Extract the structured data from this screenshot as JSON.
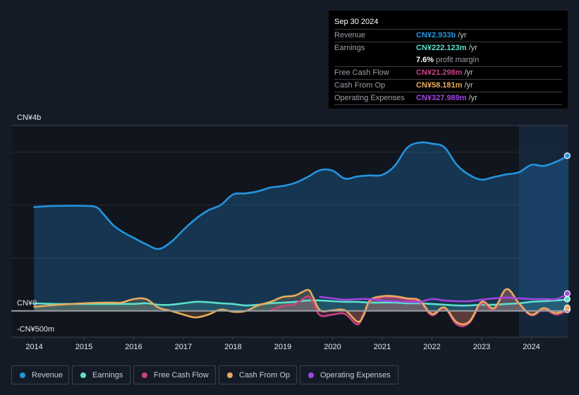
{
  "tooltip": {
    "date": "Sep 30 2024",
    "rows": [
      {
        "label": "Revenue",
        "value": "CN¥2.933b",
        "unit": "/yr",
        "color": "#2394df"
      },
      {
        "label": "Earnings",
        "value": "CN¥222.123m",
        "unit": "/yr",
        "color": "#5ce0cc"
      },
      {
        "label": "",
        "value": "7.6%",
        "unit": "profit margin",
        "color": "#ffffff"
      },
      {
        "label": "Free Cash Flow",
        "value": "CN¥21.298m",
        "unit": "/yr",
        "color": "#c64382"
      },
      {
        "label": "Cash From Op",
        "value": "CN¥58.181m",
        "unit": "/yr",
        "color": "#e8ac5c"
      },
      {
        "label": "Operating Expenses",
        "value": "CN¥327.989m",
        "unit": "/yr",
        "color": "#a245e0"
      }
    ]
  },
  "legend": [
    {
      "label": "Revenue",
      "color": "#2394df"
    },
    {
      "label": "Earnings",
      "color": "#5ce0cc"
    },
    {
      "label": "Free Cash Flow",
      "color": "#c64382"
    },
    {
      "label": "Cash From Op",
      "color": "#e8ac5c"
    },
    {
      "label": "Operating Expenses",
      "color": "#a245e0"
    }
  ],
  "chart_data": {
    "type": "area",
    "title": "",
    "xlabel": "",
    "ylabel": "",
    "y_unit": "CN¥ millions",
    "ylim": [
      -500,
      4000
    ],
    "xlim": [
      2013.55,
      2024.8
    ],
    "y_tick_labels": [
      {
        "value": 4000,
        "label": "CN¥4b"
      },
      {
        "value": 0,
        "label": "CN¥0"
      },
      {
        "value": -500,
        "label": "-CN¥500m"
      }
    ],
    "y_gridlines": [
      1000,
      2000,
      3000
    ],
    "x_ticks": [
      2014,
      2015,
      2016,
      2017,
      2018,
      2019,
      2020,
      2021,
      2022,
      2023,
      2024
    ],
    "x_tick_labels": [
      "2014",
      "2015",
      "2016",
      "2017",
      "2018",
      "2019",
      "2020",
      "2021",
      "2022",
      "2023",
      "2024"
    ],
    "highlight_range": [
      2023.75,
      2024.75
    ],
    "grid": true,
    "legend_position": "bottom-left",
    "series": [
      {
        "name": "Revenue",
        "color": "#2394df",
        "filled": true,
        "x": [
          2014.0,
          2014.3,
          2014.6,
          2015.0,
          2015.25,
          2015.4,
          2015.6,
          2015.8,
          2016.0,
          2016.25,
          2016.5,
          2016.75,
          2017.0,
          2017.25,
          2017.5,
          2017.75,
          2018.0,
          2018.25,
          2018.5,
          2018.75,
          2019.0,
          2019.25,
          2019.5,
          2019.75,
          2020.0,
          2020.25,
          2020.5,
          2020.75,
          2021.0,
          2021.25,
          2021.5,
          2021.75,
          2022.0,
          2022.25,
          2022.5,
          2022.75,
          2023.0,
          2023.25,
          2023.5,
          2023.75,
          2024.0,
          2024.25,
          2024.5,
          2024.75
        ],
        "y": [
          1960,
          1980,
          1985,
          1985,
          1960,
          1820,
          1610,
          1480,
          1380,
          1260,
          1170,
          1300,
          1530,
          1740,
          1900,
          2000,
          2200,
          2220,
          2260,
          2330,
          2360,
          2420,
          2530,
          2660,
          2650,
          2500,
          2540,
          2560,
          2570,
          2740,
          3080,
          3180,
          3160,
          3090,
          2760,
          2570,
          2480,
          2530,
          2580,
          2620,
          2760,
          2740,
          2820,
          2933
        ]
      },
      {
        "name": "Earnings",
        "color": "#5ce0cc",
        "filled": true,
        "x": [
          2014.0,
          2014.5,
          2015.0,
          2015.5,
          2016.0,
          2016.25,
          2016.5,
          2016.75,
          2017.0,
          2017.25,
          2017.5,
          2017.75,
          2018.0,
          2018.25,
          2018.5,
          2018.75,
          2019.0,
          2019.25,
          2019.5,
          2019.75,
          2020.0,
          2020.25,
          2020.5,
          2020.75,
          2021.0,
          2021.25,
          2021.5,
          2021.75,
          2022.0,
          2022.25,
          2022.5,
          2022.75,
          2023.0,
          2023.25,
          2023.5,
          2023.75,
          2024.0,
          2024.25,
          2024.5,
          2024.75
        ],
        "y": [
          143,
          130,
          130,
          130,
          130,
          143,
          116,
          116,
          143,
          170,
          163,
          143,
          130,
          103,
          116,
          143,
          156,
          170,
          196,
          196,
          183,
          170,
          170,
          156,
          156,
          156,
          143,
          143,
          130,
          116,
          103,
          103,
          116,
          116,
          130,
          143,
          170,
          183,
          196,
          222
        ]
      },
      {
        "name": "Free Cash Flow",
        "color": "#c64382",
        "filled": true,
        "x": [
          2018.75,
          2019.0,
          2019.25,
          2019.5,
          2019.6,
          2019.75,
          2020.0,
          2020.25,
          2020.5,
          2020.62,
          2020.75,
          2021.0,
          2021.25,
          2021.5,
          2021.75,
          2022.0,
          2022.25,
          2022.5,
          2022.75,
          2023.0,
          2023.25,
          2023.5,
          2023.75,
          2024.0,
          2024.25,
          2024.5,
          2024.75
        ],
        "y": [
          9,
          90,
          130,
          276,
          170,
          -84,
          -71,
          -57,
          -257,
          -57,
          170,
          250,
          250,
          210,
          170,
          -84,
          50,
          -257,
          -230,
          143,
          23,
          410,
          130,
          -84,
          23,
          -71,
          21
        ]
      },
      {
        "name": "Cash From Op",
        "color": "#e8ac5c",
        "filled": true,
        "x": [
          2014.0,
          2014.5,
          2015.0,
          2015.5,
          2015.75,
          2016.0,
          2016.25,
          2016.5,
          2016.75,
          2017.0,
          2017.25,
          2017.5,
          2017.75,
          2018.0,
          2018.25,
          2018.5,
          2018.75,
          2019.0,
          2019.25,
          2019.5,
          2019.6,
          2019.75,
          2020.0,
          2020.25,
          2020.5,
          2020.62,
          2020.75,
          2021.0,
          2021.25,
          2021.5,
          2021.75,
          2022.0,
          2022.25,
          2022.5,
          2022.75,
          2023.0,
          2023.25,
          2023.5,
          2023.75,
          2024.0,
          2024.25,
          2024.5,
          2024.75
        ],
        "y": [
          76,
          116,
          143,
          156,
          156,
          223,
          223,
          63,
          0,
          -71,
          -124,
          -71,
          23,
          -17,
          -4,
          103,
          170,
          263,
          290,
          396,
          276,
          10,
          10,
          10,
          -204,
          -97,
          196,
          276,
          276,
          236,
          196,
          -57,
          63,
          -217,
          -204,
          170,
          50,
          410,
          143,
          -71,
          50,
          -44,
          58
        ]
      },
      {
        "name": "Operating Expenses",
        "color": "#a245e0",
        "filled": false,
        "x": [
          2019.75,
          2020.0,
          2020.25,
          2020.5,
          2020.75,
          2021.0,
          2021.25,
          2021.5,
          2021.75,
          2022.0,
          2022.25,
          2022.5,
          2022.75,
          2023.0,
          2023.25,
          2023.5,
          2023.75,
          2024.0,
          2024.25,
          2024.5,
          2024.75
        ],
        "y": [
          263,
          236,
          210,
          223,
          223,
          196,
          183,
          170,
          170,
          223,
          196,
          183,
          183,
          210,
          236,
          250,
          236,
          223,
          223,
          223,
          328
        ]
      }
    ]
  }
}
